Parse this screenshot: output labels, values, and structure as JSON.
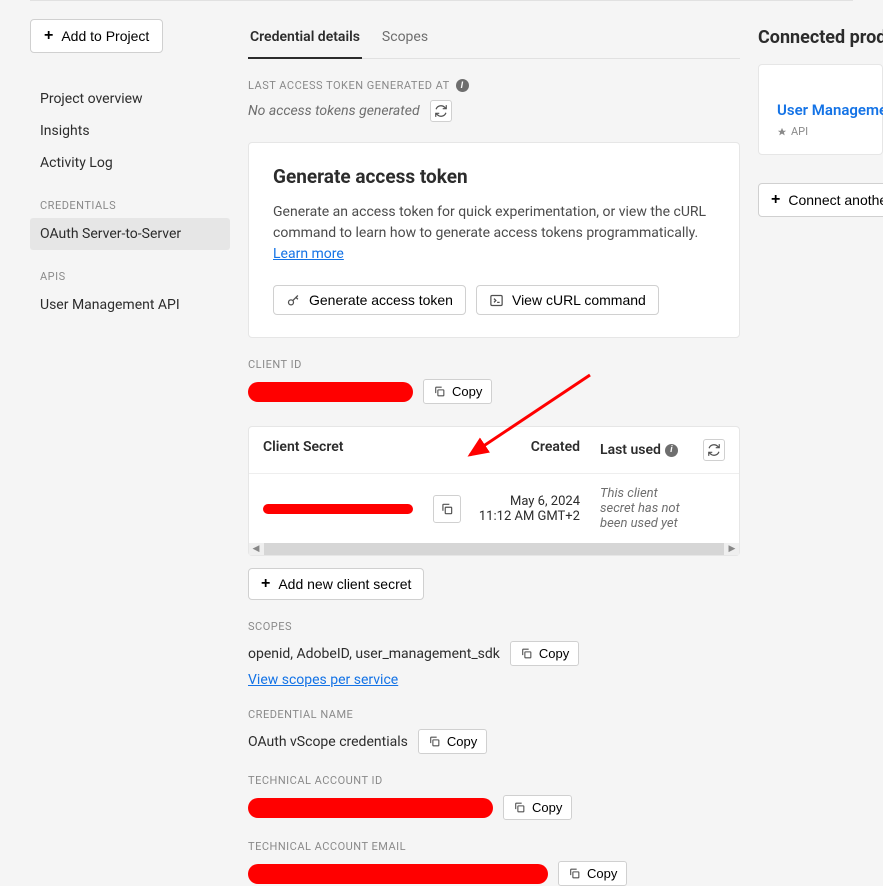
{
  "sidebar": {
    "addToProject": "Add to Project",
    "nav": {
      "overview": "Project overview",
      "insights": "Insights",
      "activity": "Activity Log"
    },
    "credentialsLabel": "CREDENTIALS",
    "credentialItem": "OAuth Server-to-Server",
    "apisLabel": "APIS",
    "apiItem": "User Management API"
  },
  "tabs": {
    "details": "Credential details",
    "scopes": "Scopes"
  },
  "lastToken": {
    "label": "LAST ACCESS TOKEN GENERATED AT",
    "none": "No access tokens generated"
  },
  "generateCard": {
    "title": "Generate access token",
    "body": "Generate an access token for quick experimentation, or view the cURL command to learn how to generate access tokens programmatically.  ",
    "learnMore": "Learn more",
    "generateBtn": "Generate access token",
    "curlBtn": "View cURL command"
  },
  "clientId": {
    "label": "CLIENT ID",
    "copy": "Copy"
  },
  "clientSecret": {
    "header": {
      "secret": "Client Secret",
      "created": "Created",
      "lastUsed": "Last used"
    },
    "row": {
      "createdDate": "May 6, 2024",
      "createdTime": "11:12 AM GMT+2",
      "lastUsed": "This client secret has not been used yet"
    },
    "addNew": "Add new client secret"
  },
  "scopes": {
    "label": "SCOPES",
    "value": "openid, AdobeID, user_management_sdk",
    "copy": "Copy",
    "viewLink": "View scopes per service"
  },
  "credName": {
    "label": "CREDENTIAL NAME",
    "value": "OAuth vScope credentials",
    "copy": "Copy"
  },
  "techId": {
    "label": "TECHNICAL ACCOUNT ID",
    "copy": "Copy"
  },
  "techEmail": {
    "label": "TECHNICAL ACCOUNT EMAIL",
    "copy": "Copy"
  },
  "right": {
    "title": "Connected products a",
    "productName": "User Management A",
    "apiLabel": "API",
    "connect": "Connect another servi"
  }
}
